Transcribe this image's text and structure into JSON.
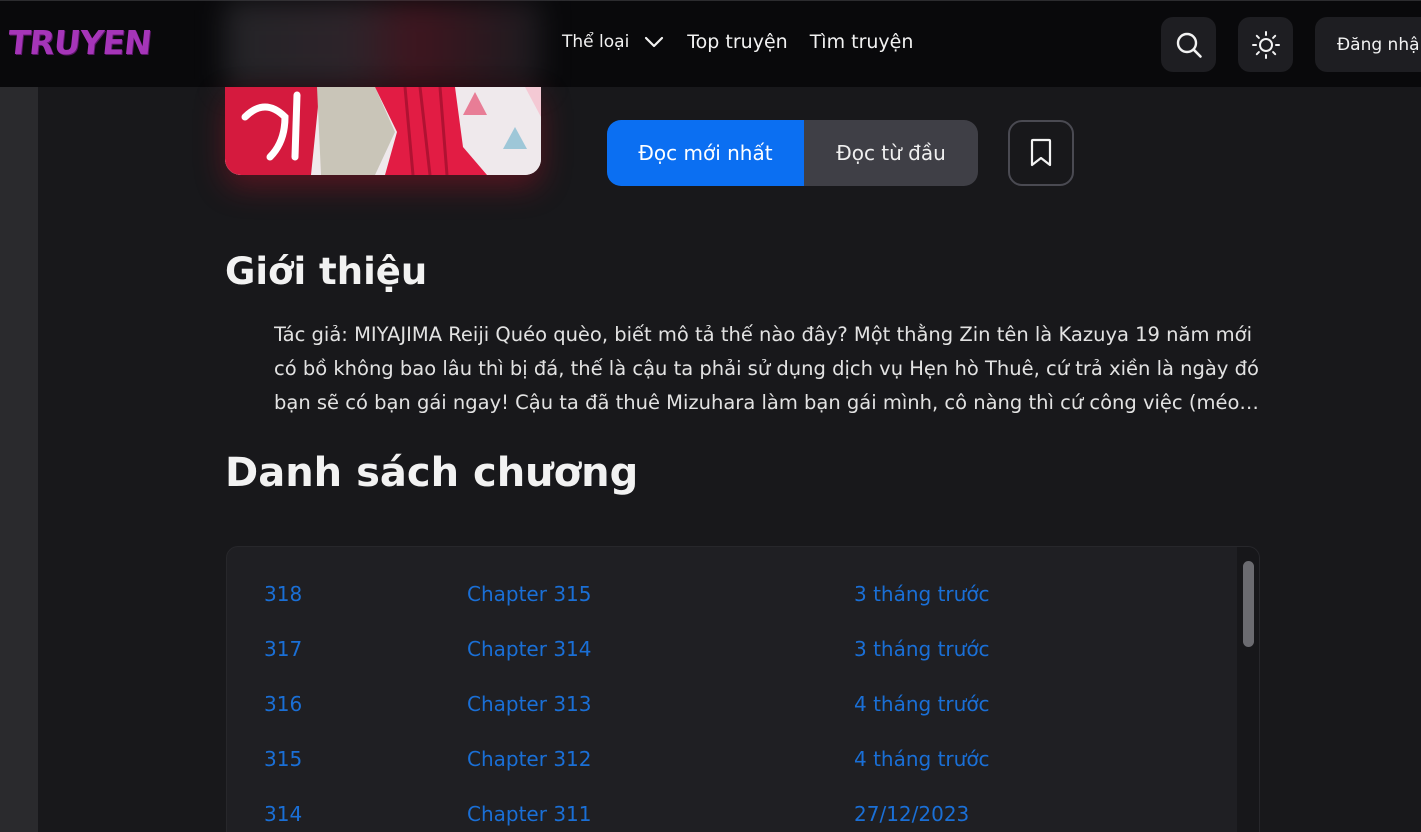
{
  "header": {
    "logo": "TRUYEN",
    "nav": {
      "genre_label": "Thể loại",
      "top_label": "Top truyện",
      "search_label": "Tìm truyện"
    },
    "login_label": "Đăng nhập"
  },
  "actions": {
    "read_latest": "Đọc mới nhất",
    "read_first": "Đọc từ đầu"
  },
  "intro": {
    "title": "Giới thiệu",
    "text": "Tác giả: MIYAJIMA Reiji Quéo quèo, biết mô tả thế nào đây? Một thằng Zin tên là Kazuya 19 năm mới có bồ không bao lâu thì bị đá, thế là cậu ta phải sử dụng dịch vụ Hẹn hò Thuê, cứ trả xiền là ngày đó bạn sẽ có bạn gái ngay! Cậu ta đã thuê Mizuhara làm bạn gái mình, cô nàng thì cứ công việc (méo ..."
  },
  "chapters": {
    "title": "Danh sách chương",
    "rows": [
      {
        "num": "318",
        "name": "Chapter 315",
        "time": "3 tháng trước"
      },
      {
        "num": "317",
        "name": "Chapter 314",
        "time": "3 tháng trước"
      },
      {
        "num": "316",
        "name": "Chapter 313",
        "time": "4 tháng trước"
      },
      {
        "num": "315",
        "name": "Chapter 312",
        "time": "4 tháng trước"
      },
      {
        "num": "314",
        "name": "Chapter 311",
        "time": "27/12/2023"
      }
    ]
  },
  "colors": {
    "accent": "#0b6ff2",
    "logo": "#a535b8",
    "link": "#1a6fd6"
  }
}
